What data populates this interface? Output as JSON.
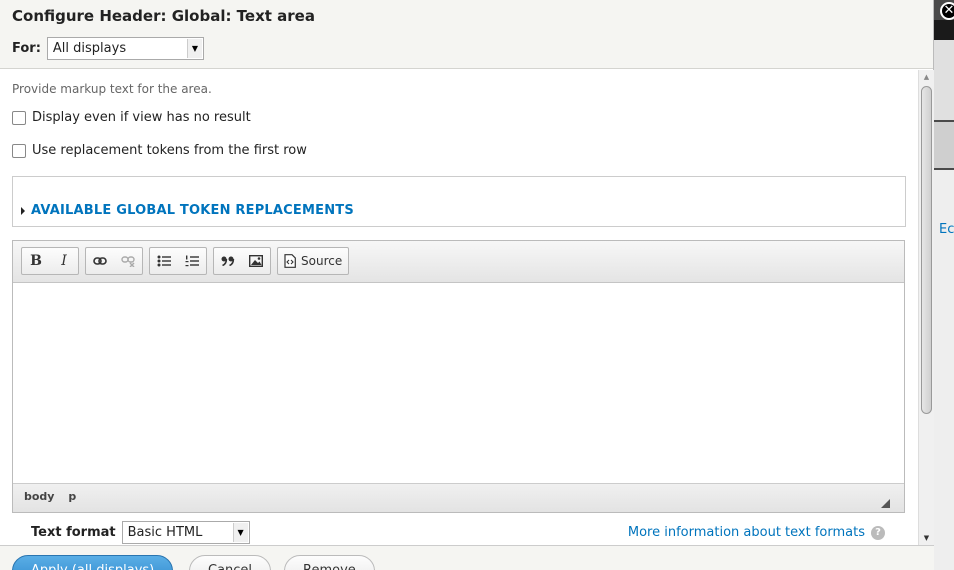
{
  "dialog": {
    "title": "Configure Header: Global: Text area",
    "for_label": "For:",
    "for_value": "All displays"
  },
  "form": {
    "description": "Provide markup text for the area.",
    "checkbox_empty": "Display even if view has no result",
    "checkbox_tokens": "Use replacement tokens from the first row",
    "token_details": "AVAILABLE GLOBAL TOKEN REPLACEMENTS"
  },
  "editor": {
    "toolbar": {
      "bold": "B",
      "italic": "I",
      "source_label": "Source"
    },
    "path": [
      "body",
      "p"
    ]
  },
  "text_format": {
    "label": "Text format",
    "value": "Basic HTML",
    "help_link": "More information about text formats",
    "help_icon": "?"
  },
  "buttons": {
    "apply": "Apply (all displays)",
    "cancel": "Cancel",
    "remove": "Remove"
  },
  "backdrop": {
    "link_fragment": "Ec"
  },
  "close_label": "✕"
}
